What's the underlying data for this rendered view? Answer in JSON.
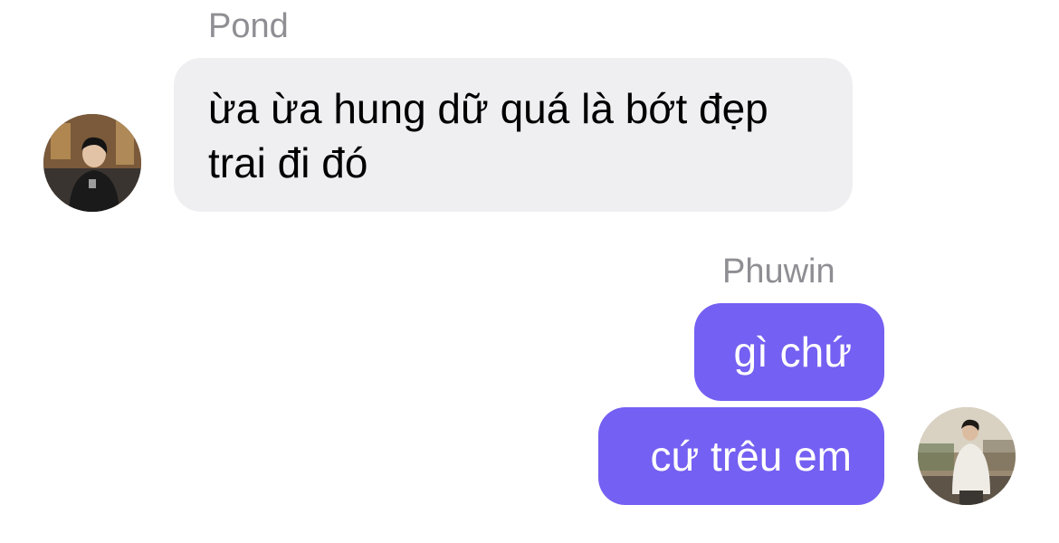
{
  "conversation": {
    "incoming": {
      "sender_name": "Pond",
      "messages": [
        {
          "text": "ừa ừa hung dữ quá là bớt đẹp trai đi đó"
        }
      ]
    },
    "outgoing": {
      "sender_name": "Phuwin",
      "messages": [
        {
          "text": "gì chứ"
        },
        {
          "text": "cứ trêu em"
        }
      ]
    }
  },
  "colors": {
    "incoming_bubble": "#efeff2",
    "outgoing_bubble": "#7460f2",
    "sender_name": "#8e8e93"
  },
  "icons": {
    "pond_avatar": "profile-photo",
    "phuwin_avatar": "profile-photo"
  }
}
